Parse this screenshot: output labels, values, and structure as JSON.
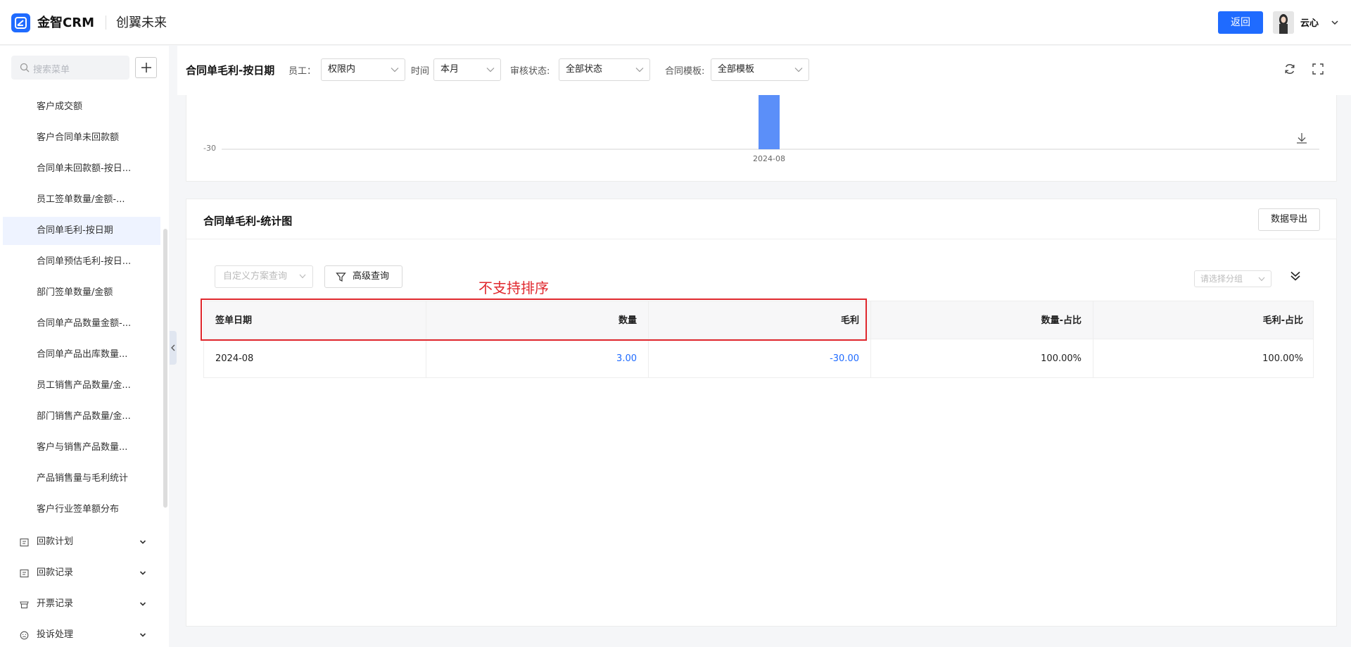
{
  "app": {
    "brand": "金智CRM",
    "org": "创翼未来"
  },
  "topbar": {
    "back_label": "返回",
    "username": "云心"
  },
  "sidebar": {
    "search_placeholder": "搜索菜单",
    "items": [
      {
        "label": "客户成交额"
      },
      {
        "label": "客户合同单未回款额"
      },
      {
        "label": "合同单未回款额-按日..."
      },
      {
        "label": "员工签单数量/金额-..."
      },
      {
        "label": "合同单毛利-按日期",
        "active": true
      },
      {
        "label": "合同单预估毛利-按日..."
      },
      {
        "label": "部门签单数量/金额"
      },
      {
        "label": "合同单产品数量金额-..."
      },
      {
        "label": "合同单产品出库数量..."
      },
      {
        "label": "员工销售产品数量/金..."
      },
      {
        "label": "部门销售产品数量/金..."
      },
      {
        "label": "客户与销售产品数量..."
      },
      {
        "label": "产品销售量与毛利统计"
      },
      {
        "label": "客户行业签单额分布"
      }
    ],
    "groups": [
      {
        "label": "回款计划",
        "icon": "receipt-icon"
      },
      {
        "label": "回款记录",
        "icon": "receipt-icon"
      },
      {
        "label": "开票记录",
        "icon": "invoice-icon"
      },
      {
        "label": "投诉处理",
        "icon": "complaint-icon"
      }
    ]
  },
  "filters": {
    "page_title": "合同单毛利-按日期",
    "employee_label": "员工：",
    "employee_value": "权限内",
    "time_label": "时间",
    "time_value": "本月",
    "audit_label": "审核状态:",
    "audit_value": "全部状态",
    "template_label": "合同模板:",
    "template_value": "全部模板"
  },
  "chart_data": {
    "type": "bar",
    "categories": [
      "2024-08"
    ],
    "values": [
      -30
    ],
    "ytick_visible": "-30",
    "bar_color": "#5b8ff9"
  },
  "panel": {
    "title": "合同单毛利-统计图",
    "export_label": "数据导出",
    "custom_query_placeholder": "自定义方案查询",
    "advanced_query_label": "高级查询",
    "group_placeholder": "请选择分组",
    "annotation": "不支持排序"
  },
  "table": {
    "columns": [
      "签单日期",
      "数量",
      "毛利",
      "数量-占比",
      "毛利-占比"
    ],
    "rows": [
      {
        "date": "2024-08",
        "qty": "3.00",
        "profit": "-30.00",
        "qty_ratio": "100.00%",
        "profit_ratio": "100.00%"
      }
    ]
  },
  "colors": {
    "accent": "#1f6bff",
    "annotation_red": "#e0282e"
  }
}
